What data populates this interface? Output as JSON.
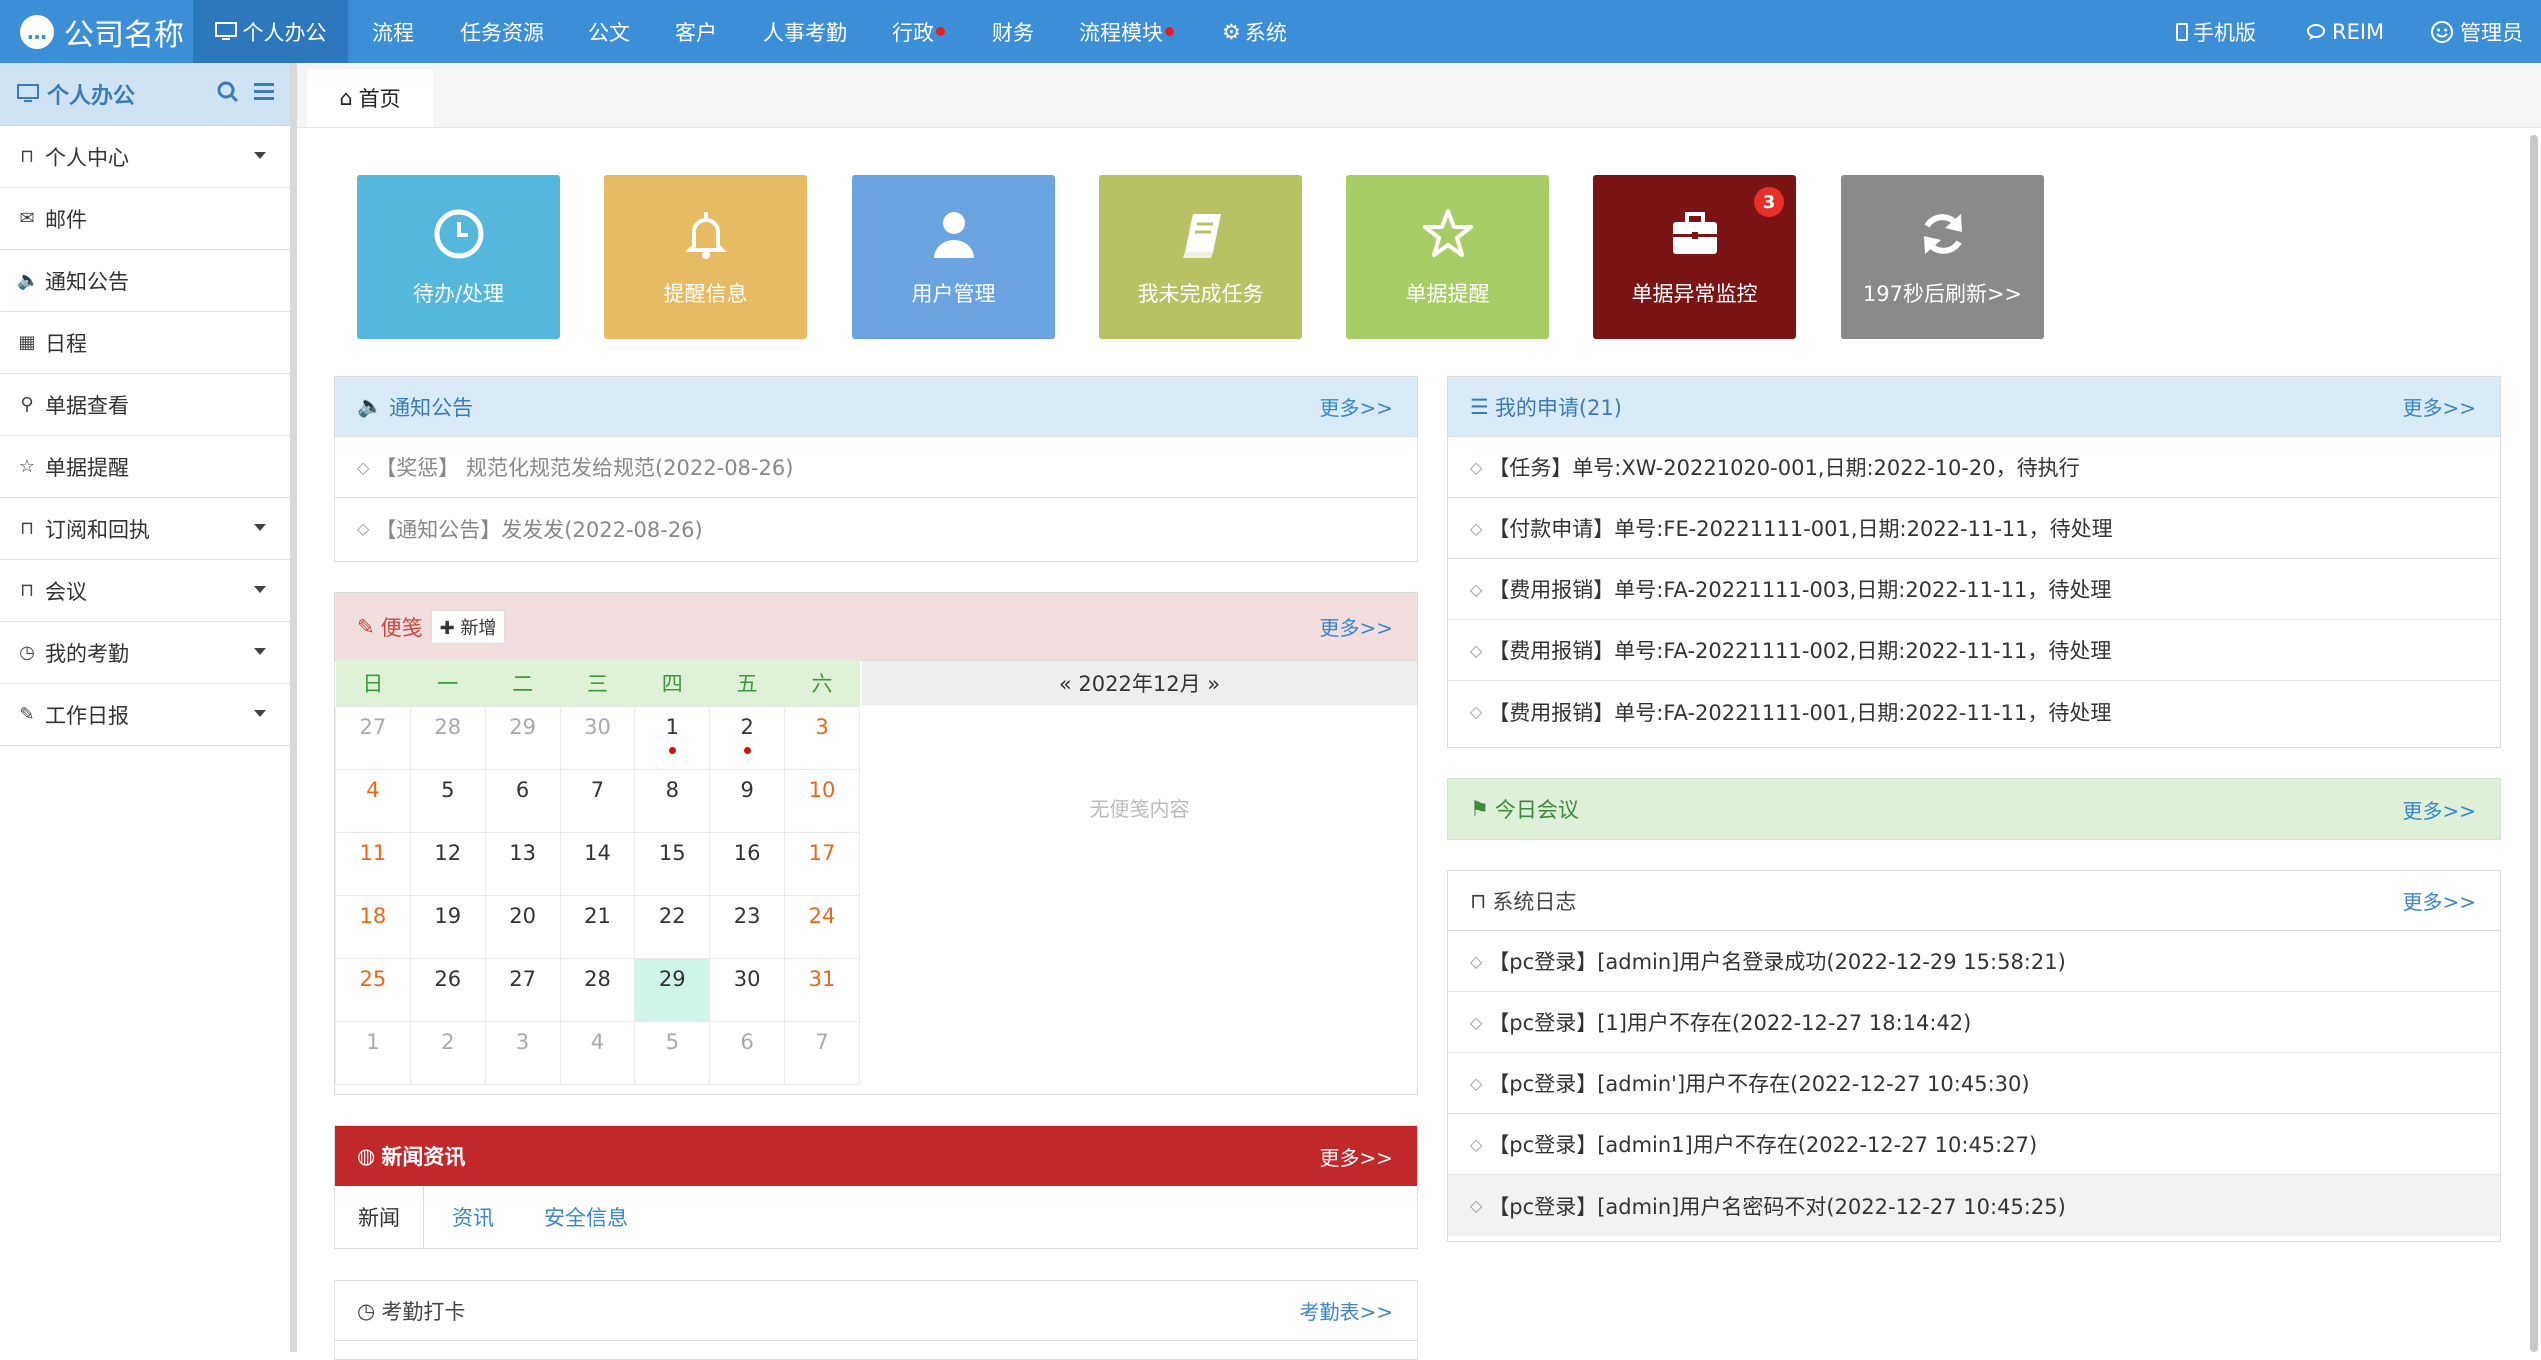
{
  "topnav": {
    "brand": "公司名称",
    "items": [
      {
        "label": "个人办公",
        "icon": "monitor-icon",
        "active": true
      },
      {
        "label": "流程"
      },
      {
        "label": "任务资源"
      },
      {
        "label": "公文"
      },
      {
        "label": "客户"
      },
      {
        "label": "人事考勤"
      },
      {
        "label": "行政",
        "dot": true
      },
      {
        "label": "财务"
      },
      {
        "label": "流程模块",
        "dot": true
      },
      {
        "label": "系统",
        "icon": "gear-icon"
      }
    ],
    "right": [
      {
        "label": "手机版",
        "icon": "mobile-icon"
      },
      {
        "label": "REIM",
        "icon": "chat-icon"
      },
      {
        "label": "管理员",
        "icon": "avatar-icon"
      }
    ]
  },
  "sidebar": {
    "title": "个人办公",
    "items": [
      {
        "label": "个人中心",
        "icon": "bookmark-icon",
        "caret": true
      },
      {
        "label": "邮件",
        "icon": "envelope-icon"
      },
      {
        "label": "通知公告",
        "icon": "volume-icon"
      },
      {
        "label": "日程",
        "icon": "calendar-icon"
      },
      {
        "label": "单据查看",
        "icon": "search-icon"
      },
      {
        "label": "单据提醒",
        "icon": "star-icon"
      },
      {
        "label": "订阅和回执",
        "icon": "bookmark-icon",
        "caret": true
      },
      {
        "label": "会议",
        "icon": "bookmark-icon",
        "caret": true
      },
      {
        "label": "我的考勤",
        "icon": "clock-icon",
        "caret": true
      },
      {
        "label": "工作日报",
        "icon": "edit-icon",
        "caret": true
      }
    ]
  },
  "tabs": {
    "home": "首页"
  },
  "tiles": [
    {
      "label": "待办/处理",
      "icon": "clock-icon",
      "color": "#54b7db"
    },
    {
      "label": "提醒信息",
      "icon": "bell-icon",
      "color": "#e7ba64"
    },
    {
      "label": "用户管理",
      "icon": "user-icon",
      "color": "#6ba3e0"
    },
    {
      "label": "我未完成任务",
      "icon": "book-icon",
      "color": "#b8c265"
    },
    {
      "label": "单据提醒",
      "icon": "star-icon",
      "color": "#a8cd67"
    },
    {
      "label": "单据异常监控",
      "icon": "briefcase-icon",
      "color": "#7b1414",
      "badge": "3"
    },
    {
      "label": "197秒后刷新>>",
      "icon": "refresh-icon",
      "color": "#8a8a8a"
    }
  ],
  "notice": {
    "title": "通知公告",
    "more": "更多>>",
    "items": [
      "【奖惩】 规范化规范发给规范(2022-08-26)",
      "【通知公告】发发发(2022-08-26)"
    ]
  },
  "memo": {
    "title": "便笺",
    "add": "新增",
    "more": "更多>>",
    "weekdays": [
      "日",
      "一",
      "二",
      "三",
      "四",
      "五",
      "六"
    ],
    "month_label": "« 2022年12月 »",
    "empty": "无便笺内容",
    "weeks": [
      [
        "27",
        "28",
        "29",
        "30",
        "1",
        "2",
        "3"
      ],
      [
        "4",
        "5",
        "6",
        "7",
        "8",
        "9",
        "10"
      ],
      [
        "11",
        "12",
        "13",
        "14",
        "15",
        "16",
        "17"
      ],
      [
        "18",
        "19",
        "20",
        "21",
        "22",
        "23",
        "24"
      ],
      [
        "25",
        "26",
        "27",
        "28",
        "29",
        "30",
        "31"
      ],
      [
        "1",
        "2",
        "3",
        "4",
        "5",
        "6",
        "7"
      ]
    ]
  },
  "news": {
    "title": "新闻资讯",
    "more": "更多>>",
    "tabs": [
      "新闻",
      "资讯",
      "安全信息"
    ]
  },
  "attendance": {
    "title": "考勤打卡",
    "more": "考勤表>>"
  },
  "my_requests": {
    "title": "我的申请(21)",
    "more": "更多>>",
    "items": [
      "【任务】单号:XW-20221020-001,日期:2022-10-20，待执行",
      "【付款申请】单号:FE-20221111-001,日期:2022-11-11，待处理",
      "【费用报销】单号:FA-20221111-003,日期:2022-11-11，待处理",
      "【费用报销】单号:FA-20221111-002,日期:2022-11-11，待处理",
      "【费用报销】单号:FA-20221111-001,日期:2022-11-11，待处理"
    ]
  },
  "meeting": {
    "title": "今日会议",
    "more": "更多>>"
  },
  "syslog": {
    "title": "系统日志",
    "more": "更多>>",
    "items": [
      "【pc登录】[admin]用户名登录成功(2022-12-29 15:58:21)",
      "【pc登录】[1]用户不存在(2022-12-27 18:14:42)",
      "【pc登录】[admin']用户不存在(2022-12-27 10:45:30)",
      "【pc登录】[admin1]用户不存在(2022-12-27 10:45:27)",
      "【pc登录】[admin]用户名密码不对(2022-12-27 10:45:25)"
    ]
  }
}
